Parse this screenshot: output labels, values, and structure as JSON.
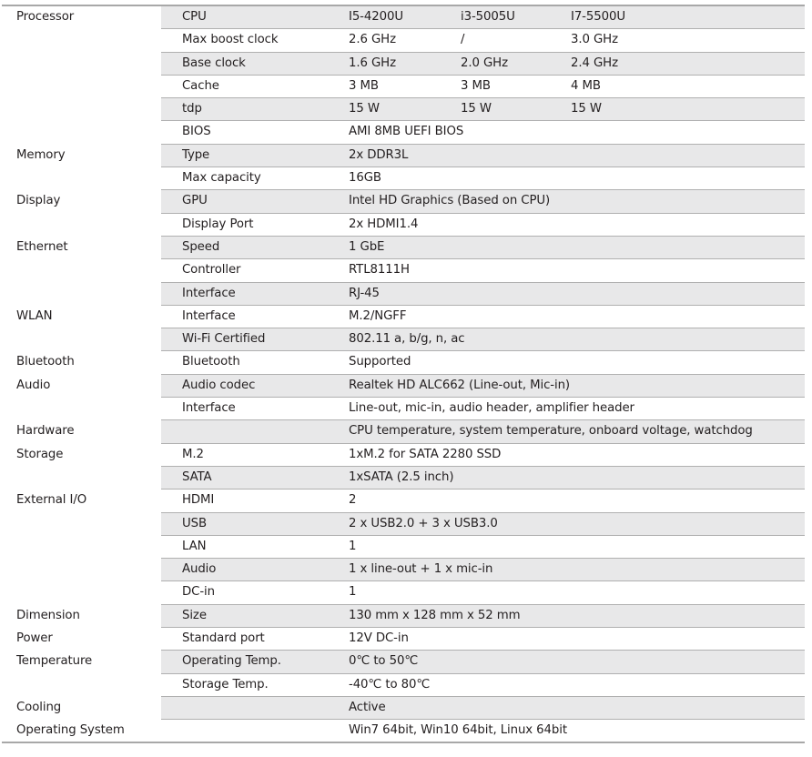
{
  "table": {
    "rows": [
      {
        "category": "Processor",
        "item": "CPU",
        "values": [
          "I5-4200U",
          "i3-5005U",
          "I7-5500U"
        ],
        "shaded": true
      },
      {
        "category": "",
        "item": "Max boost clock",
        "values": [
          "2.6 GHz",
          "/",
          "3.0 GHz"
        ],
        "shaded": false
      },
      {
        "category": "",
        "item": "Base clock",
        "values": [
          "1.6 GHz",
          "2.0 GHz",
          "2.4 GHz"
        ],
        "shaded": true
      },
      {
        "category": "",
        "item": "Cache",
        "values": [
          "3 MB",
          "3 MB",
          "4 MB"
        ],
        "shaded": false
      },
      {
        "category": "",
        "item": "tdp",
        "values": [
          "15 W",
          "15 W",
          "15 W"
        ],
        "shaded": true
      },
      {
        "category": "",
        "item": "BIOS",
        "values": [
          "AMI 8MB UEFI BIOS"
        ],
        "shaded": false
      },
      {
        "category": "Memory",
        "item": "Type",
        "values": [
          "2x DDR3L"
        ],
        "shaded": true
      },
      {
        "category": "",
        "item": "Max capacity",
        "values": [
          "16GB"
        ],
        "shaded": false
      },
      {
        "category": "Display",
        "item": "GPU",
        "values": [
          "Intel HD Graphics (Based on CPU)"
        ],
        "shaded": true
      },
      {
        "category": "",
        "item": "Display Port",
        "values": [
          "2x HDMI1.4"
        ],
        "shaded": false
      },
      {
        "category": "Ethernet",
        "item": "Speed",
        "values": [
          "1 GbE"
        ],
        "shaded": true
      },
      {
        "category": "",
        "item": "Controller",
        "values": [
          "RTL8111H"
        ],
        "shaded": false
      },
      {
        "category": "",
        "item": "Interface",
        "values": [
          "RJ-45"
        ],
        "shaded": true
      },
      {
        "category": "WLAN",
        "item": "Interface",
        "values": [
          "M.2/NGFF"
        ],
        "shaded": false
      },
      {
        "category": "",
        "item": "Wi-Fi Certified",
        "values": [
          "802.11 a, b/g, n, ac"
        ],
        "shaded": true
      },
      {
        "category": "Bluetooth",
        "item": "Bluetooth",
        "values": [
          "Supported"
        ],
        "shaded": false
      },
      {
        "category": "Audio",
        "item": "Audio codec",
        "values": [
          "Realtek HD ALC662 (Line-out, Mic-in)"
        ],
        "shaded": true
      },
      {
        "category": "",
        "item": "Interface",
        "values": [
          "Line-out, mic-in, audio header, amplifier header"
        ],
        "shaded": false
      },
      {
        "category": "Hardware",
        "item": "",
        "values": [
          "CPU temperature, system temperature, onboard voltage, watchdog"
        ],
        "shaded": true
      },
      {
        "category": "Storage",
        "item": "M.2",
        "values": [
          "1xM.2 for SATA 2280 SSD"
        ],
        "shaded": false
      },
      {
        "category": "",
        "item": "SATA",
        "values": [
          "1xSATA (2.5 inch)"
        ],
        "shaded": true
      },
      {
        "category": "External I/O",
        "item": "HDMI",
        "values": [
          "2"
        ],
        "shaded": false
      },
      {
        "category": "",
        "item": "USB",
        "values": [
          "2 x USB2.0 + 3 x USB3.0"
        ],
        "shaded": true
      },
      {
        "category": "",
        "item": "LAN",
        "values": [
          "1"
        ],
        "shaded": false
      },
      {
        "category": "",
        "item": "Audio",
        "values": [
          "1 x line-out + 1 x mic-in"
        ],
        "shaded": true
      },
      {
        "category": "",
        "item": "DC-in",
        "values": [
          "1"
        ],
        "shaded": false
      },
      {
        "category": "Dimension",
        "item": "Size",
        "values": [
          "130 mm x 128 mm x 52 mm"
        ],
        "shaded": true
      },
      {
        "category": "Power",
        "item": "Standard port",
        "values": [
          "12V DC-in"
        ],
        "shaded": false
      },
      {
        "category": "Temperature",
        "item": "Operating Temp.",
        "values": [
          "0℃ to 50℃"
        ],
        "shaded": true
      },
      {
        "category": "",
        "item": "Storage Temp.",
        "values": [
          "-40℃ to 80℃"
        ],
        "shaded": false
      },
      {
        "category": "Cooling",
        "item": "",
        "values": [
          "Active"
        ],
        "shaded": true
      },
      {
        "category": "Operating System",
        "item": "",
        "values": [
          "Win7 64bit, Win10 64bit, Linux 64bit"
        ],
        "shaded": false
      }
    ]
  }
}
